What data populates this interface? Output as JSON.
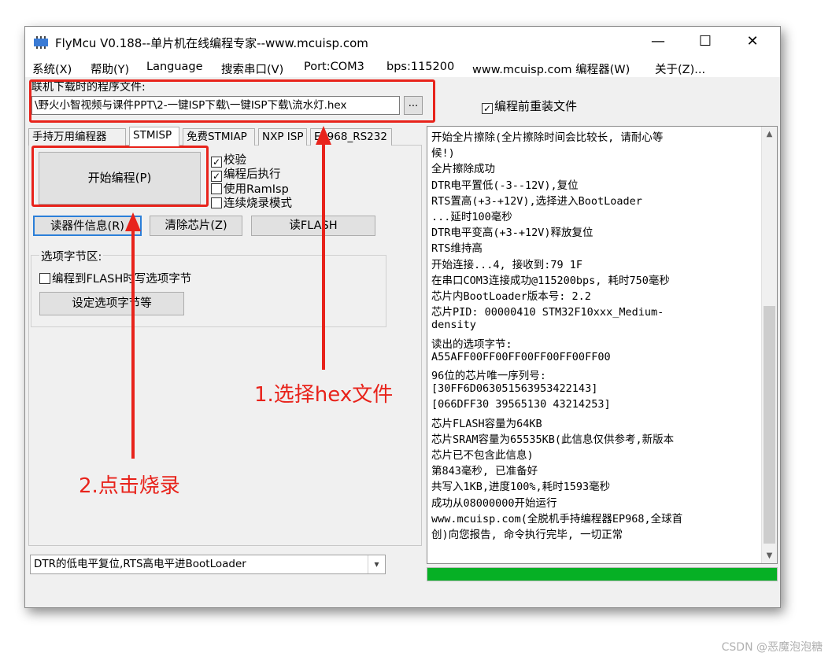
{
  "window": {
    "title": "FlyMcu V0.188--单片机在线编程专家--www.mcuisp.com",
    "minimize": "—",
    "maximize": "☐",
    "close": "✕"
  },
  "menu": [
    "系统(X)",
    "帮助(Y)",
    "Language",
    "搜索串口(V)",
    "Port:COM3",
    "bps:115200",
    "www.mcuisp.com 编程器(W)",
    "关于(Z)..."
  ],
  "file": {
    "label": "联机下载时的程序文件:",
    "path": "\\野火小智视频与课件PPT\\2-一键ISP下载\\一键ISP下载\\流水灯.hex",
    "browse": "...",
    "reload_label": "编程前重装文件",
    "reload_checked": true
  },
  "tabs": [
    "手持万用编程器",
    "STMISP",
    "免费STMIAP",
    "NXP ISP",
    "EP968_RS232"
  ],
  "stmisp": {
    "start_button": "开始编程(P)",
    "options": [
      {
        "label": "校验",
        "checked": true
      },
      {
        "label": "编程后执行",
        "checked": true
      },
      {
        "label": "使用RamIsp",
        "checked": false
      },
      {
        "label": "连续烧录模式",
        "checked": false
      }
    ],
    "read_info": "读器件信息(R)",
    "erase_chip": "清除芯片(Z)",
    "read_flash": "读FLASH",
    "option_group_title": "选项字节区:",
    "program_option_bytes": "编程到FLASH时写选项字节",
    "set_option_bytes": "设定选项字节等"
  },
  "reset_mode": "DTR的低电平复位,RTS高电平进BootLoader",
  "log": [
    "开始全片擦除(全片擦除时间会比较长, 请耐心等",
    "候!)",
    "全片擦除成功",
    "DTR电平置低(-3--12V),复位",
    "RTS置高(+3-+12V),选择进入BootLoader",
    "...延时100毫秒",
    "DTR电平变高(+3-+12V)释放复位",
    "RTS维持高",
    "开始连接...4, 接收到:79 1F",
    "在串口COM3连接成功@115200bps, 耗时750毫秒",
    "芯片内BootLoader版本号: 2.2",
    "芯片PID: 00000410  STM32F10xxx_Medium-",
    "density",
    "读出的选项字节:",
    "A55AFF00FF00FF00FF00FF00FF00",
    "96位的芯片唯一序列号:",
    "[30FF6D063051563953422143]",
    "[066DFF30 39565130 43214253]",
    "芯片FLASH容量为64KB",
    "芯片SRAM容量为65535KB(此信息仅供参考,新版本",
    "芯片已不包含此信息)",
    "第843毫秒, 已准备好",
    "共写入1KB,进度100%,耗时1593毫秒",
    "成功从08000000开始运行",
    "www.mcuisp.com(全脱机手持编程器EP968,全球首",
    "创)向您报告, 命令执行完毕, 一切正常"
  ],
  "progress": 1.0,
  "annotations": {
    "step1": "1.选择hex文件",
    "step2": "2.点击烧录"
  },
  "watermark": "CSDN @恶魔泡泡糖",
  "colors": {
    "annotation": "#e8231b",
    "progress": "#06b025"
  }
}
